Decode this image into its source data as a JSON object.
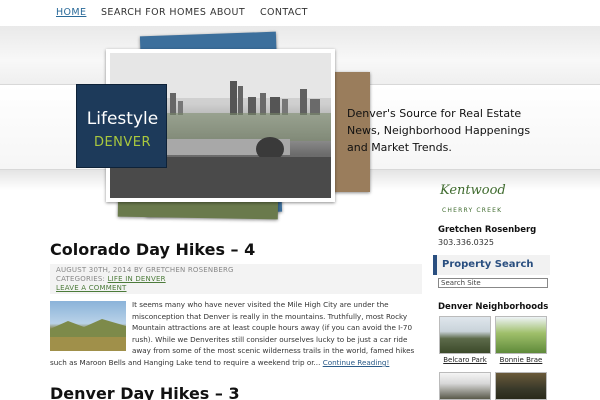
{
  "nav": {
    "items": [
      {
        "label": "HOME",
        "active": true
      },
      {
        "label": "SEARCH FOR HOMES",
        "active": false
      },
      {
        "label": "ABOUT",
        "active": false
      },
      {
        "label": "CONTACT",
        "active": false
      }
    ]
  },
  "header": {
    "logo": {
      "line1": "Lifestyle",
      "line2": "DENVER"
    },
    "tagline": "Denver's Source for Real Estate News, Neighborhood Happenings and Market Trends."
  },
  "post": {
    "title": "Colorado Day Hikes – 4",
    "date_line": "AUGUST 30TH, 2014 BY GRETCHEN ROSENBERG",
    "categories_label": "CATEGORIES:",
    "category": "LIFE IN DENVER",
    "comment_link": "LEAVE A COMMENT",
    "excerpt": "It seems many who have never visited the Mile High City are under the misconception that Denver is really in the mountains. Truthfully, most Rocky Mountain attractions are at least couple hours away (if you can avoid the I-70 rush). While we Denverites still consider ourselves lucky to be just a car ride away from some of the most scenic wilderness trails in the world, famed hikes such as Maroon Bells and Hanging Lake tend to require a weekend trip or...",
    "more_link": "Continue Reading!"
  },
  "next_post": {
    "title": "Denver Day Hikes – 3"
  },
  "sidebar": {
    "brand": {
      "name": "Kentwood",
      "sub": "CHERRY CREEK"
    },
    "agent_name": "Gretchen Rosenberg",
    "agent_phone": "303.336.0325",
    "property_search": {
      "title": "Property Search",
      "input_value": "Search Site"
    },
    "neighborhoods": {
      "title": "Denver Neighborhoods",
      "items": [
        {
          "label": "Belcaro Park"
        },
        {
          "label": "Bonnie Brae"
        }
      ]
    }
  },
  "colors": {
    "accent": "#2a4f80",
    "nav_active": "#2a6a99",
    "brand_green": "#3f6b2e",
    "logo_bg": "#1d3a5a"
  }
}
